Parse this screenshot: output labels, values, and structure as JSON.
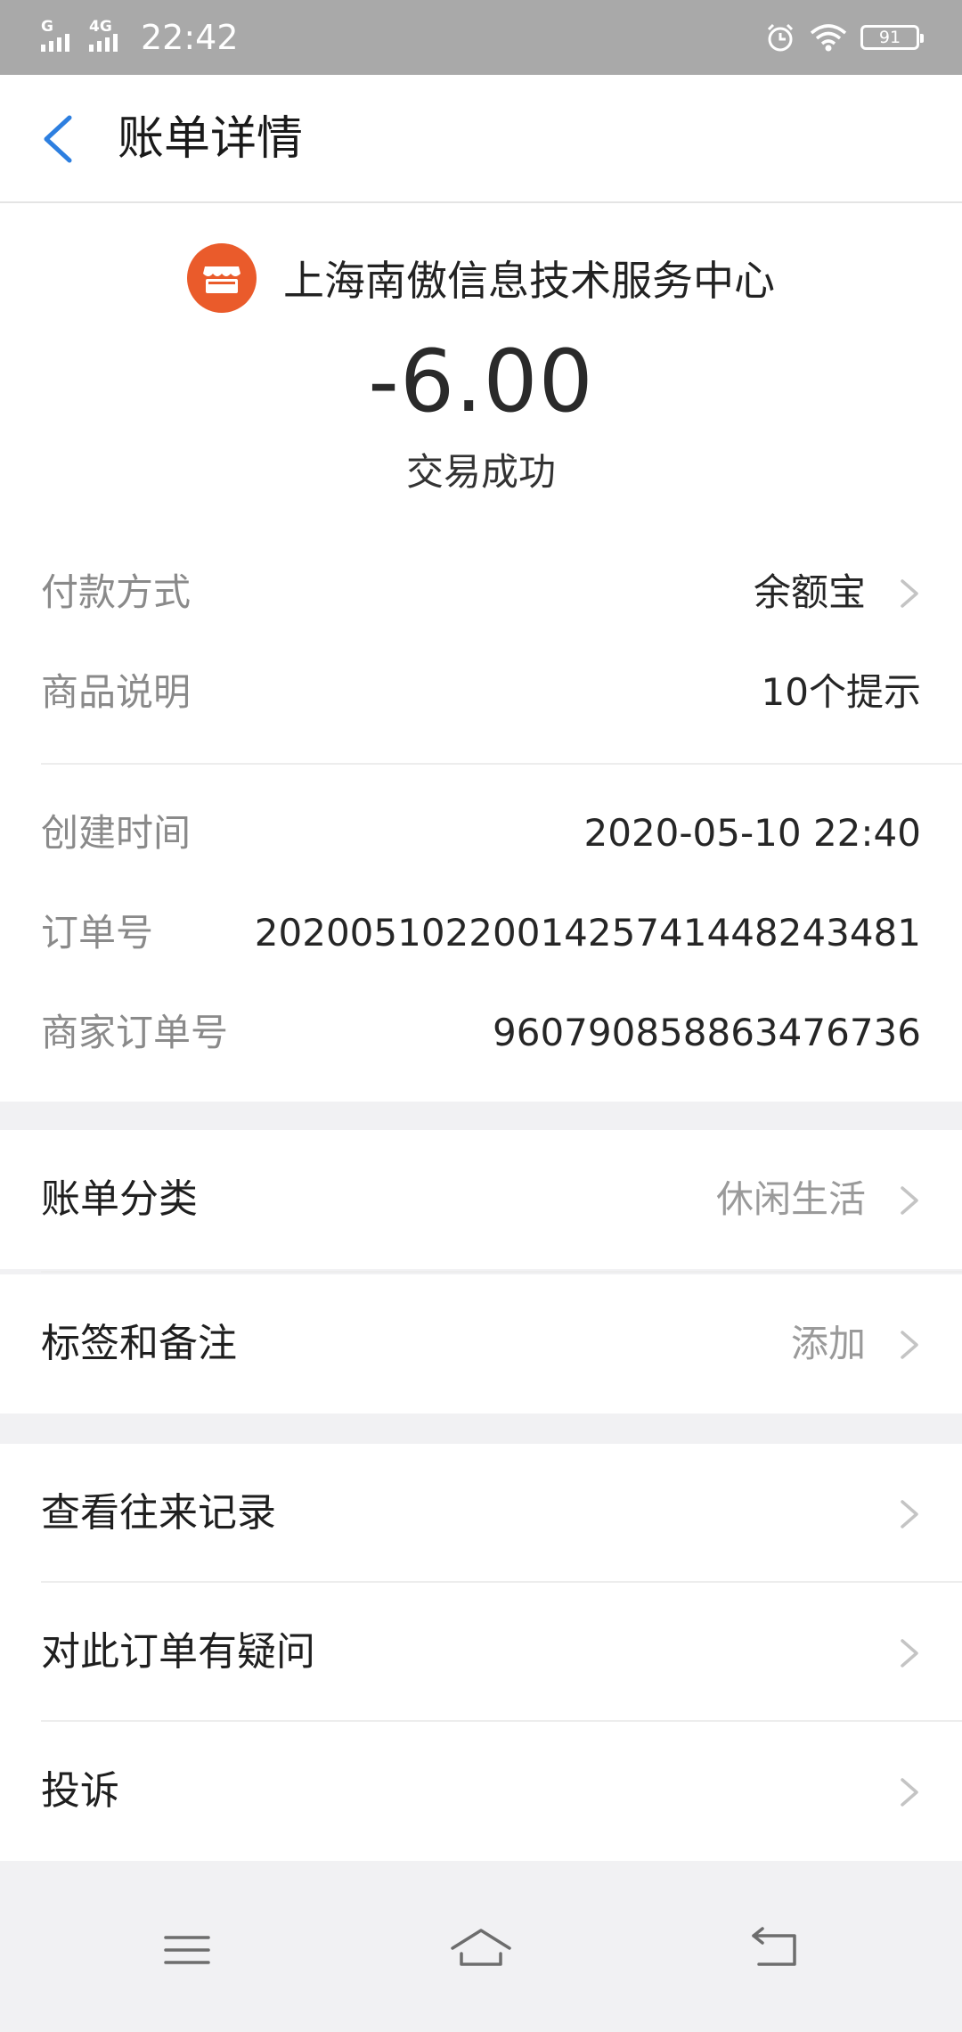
{
  "status_bar": {
    "network_1": "G",
    "network_2": "4G",
    "time": "22:42",
    "battery": "91",
    "icons": [
      "alarm-icon",
      "wifi-icon",
      "battery-icon"
    ]
  },
  "header": {
    "title": "账单详情",
    "back_icon": "chevron-left-icon"
  },
  "summary": {
    "merchant_name": "上海南傲信息技术服务中心",
    "merchant_icon": "store-icon",
    "amount": "-6.00",
    "status": "交易成功"
  },
  "details": [
    {
      "label": "付款方式",
      "value": "余额宝",
      "chevron": true
    },
    {
      "label": "商品说明",
      "value": "10个提示",
      "chevron": false
    },
    {
      "label": "创建时间",
      "value": "2020-05-10 22:40",
      "chevron": false
    },
    {
      "label": "订单号",
      "value": "2020051022001425741448243481",
      "chevron": false
    },
    {
      "label": "商家订单号",
      "value": "960790858863476736",
      "chevron": false
    }
  ],
  "bill_settings": [
    {
      "label": "账单分类",
      "value": "休闲生活"
    },
    {
      "label": "标签和备注",
      "value": "添加"
    }
  ],
  "actions": [
    {
      "label": "查看往来记录"
    },
    {
      "label": "对此订单有疑问"
    },
    {
      "label": "投诉"
    }
  ],
  "colors": {
    "accent_blue": "#2d7fe0",
    "merchant_orange": "#ea5b2b",
    "status_bar_gray": "#a9a9a9",
    "page_bg": "#f1f1f3"
  }
}
